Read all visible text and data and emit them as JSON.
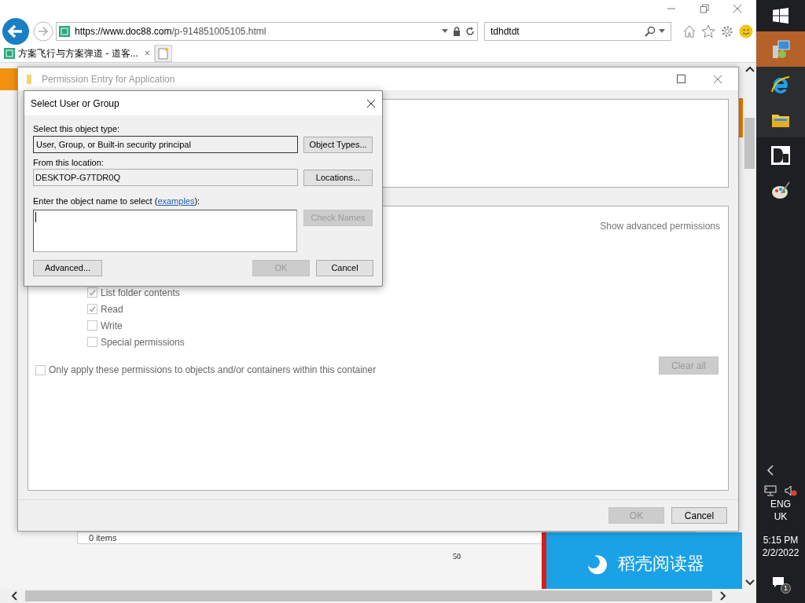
{
  "browser": {
    "url_host": "https://www.doc88.com",
    "url_path": "/p-914851005105.html",
    "search": "tdhdtdt",
    "tab_title": "方案飞行与方案弹道 - 道客...",
    "tab_close": "×"
  },
  "page_behind": {
    "status": "0 items",
    "page_number": "50",
    "banner": "稻壳阅读器"
  },
  "permission_window": {
    "title": "Permission Entry for Application",
    "show_advanced": "Show advanced permissions",
    "permissions": [
      {
        "label": "List folder contents",
        "checked": true
      },
      {
        "label": "Read",
        "checked": true
      },
      {
        "label": "Write",
        "checked": false
      },
      {
        "label": "Special permissions",
        "checked": false
      }
    ],
    "only_apply": {
      "label": "Only apply these permissions to objects and/or containers within this container",
      "checked": false
    },
    "clear_all": {
      "label": "Clear all",
      "disabled": true
    },
    "buttons": [
      {
        "label": "OK",
        "disabled": true
      },
      {
        "label": "Cancel",
        "disabled": false
      }
    ]
  },
  "select_dialog": {
    "title": "Select User or Group",
    "object_type_label": "Select this object type:",
    "object_type": "User, Group, or Built-in security principal",
    "object_types_button": "Object Types...",
    "location_label": "From this location:",
    "location": "DESKTOP-G7TDR0Q",
    "locations_button": "Locations...",
    "name_label_before": "Enter the object name to select (",
    "link": "examples",
    "name_label_after": "):",
    "check_names": {
      "label": "Check Names",
      "disabled": true
    },
    "advanced": "Advanced...",
    "buttons": [
      {
        "label": "OK",
        "disabled": true
      },
      {
        "label": "Cancel",
        "disabled": false
      }
    ]
  },
  "taskbar": {
    "language": "ENG",
    "region": "UK",
    "time": "5:15 PM",
    "date": "2/2/2022",
    "notifications": "1"
  }
}
